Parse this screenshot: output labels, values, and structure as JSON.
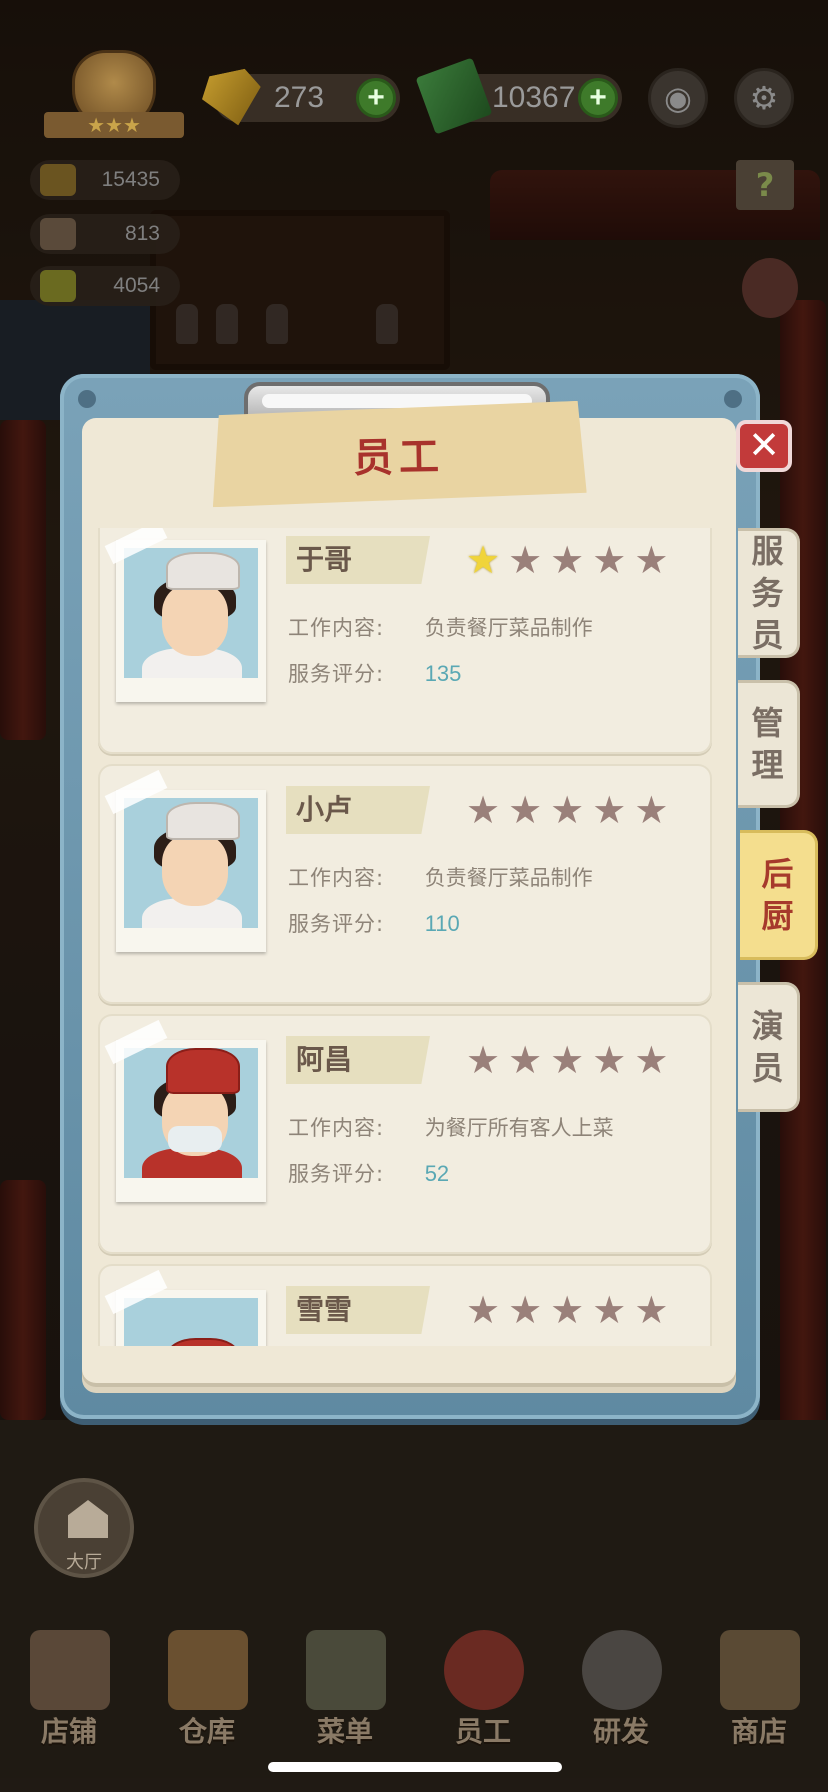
{
  "hud": {
    "stars": "★★★",
    "gems": "273",
    "cash": "10367",
    "plus": "+",
    "camera_icon": "◉",
    "settings_icon": "⚙",
    "stats": [
      "15435",
      "813",
      "4054"
    ],
    "help_icon": "?"
  },
  "modal": {
    "title": "员工",
    "close_label": "✕",
    "tabs": [
      {
        "label": "服务员",
        "chars": [
          "服",
          "务",
          "员"
        ]
      },
      {
        "label": "管理",
        "chars": [
          "管",
          "理"
        ]
      },
      {
        "label": "后厨",
        "chars": [
          "后",
          "厨"
        ]
      },
      {
        "label": "演员",
        "chars": [
          "演",
          "员"
        ]
      }
    ],
    "active_tab": "后厨",
    "field_labels": {
      "job": "工作内容:",
      "score": "服务评分:"
    },
    "employees": [
      {
        "name": "于哥",
        "stars": 1,
        "job": "负责餐厅菜品制作",
        "score": "135"
      },
      {
        "name": "小卢",
        "stars": 0,
        "job": "负责餐厅菜品制作",
        "score": "110"
      },
      {
        "name": "阿昌",
        "stars": 0,
        "job": "为餐厅所有客人上菜",
        "score": "52"
      },
      {
        "name": "雪雪",
        "stars": 0,
        "job": "",
        "score": ""
      }
    ]
  },
  "hall_button": "大厅",
  "nav": [
    "店铺",
    "仓库",
    "菜单",
    "员工",
    "研发",
    "商店"
  ],
  "colors": {
    "frame": "#6f97ad",
    "paper": "#efe8d6",
    "title": "#a8322c",
    "score": "#5aa8b4",
    "star_on": "#f0d43a",
    "star_off": "#9a807a",
    "active_tab": "#f4de8e"
  }
}
